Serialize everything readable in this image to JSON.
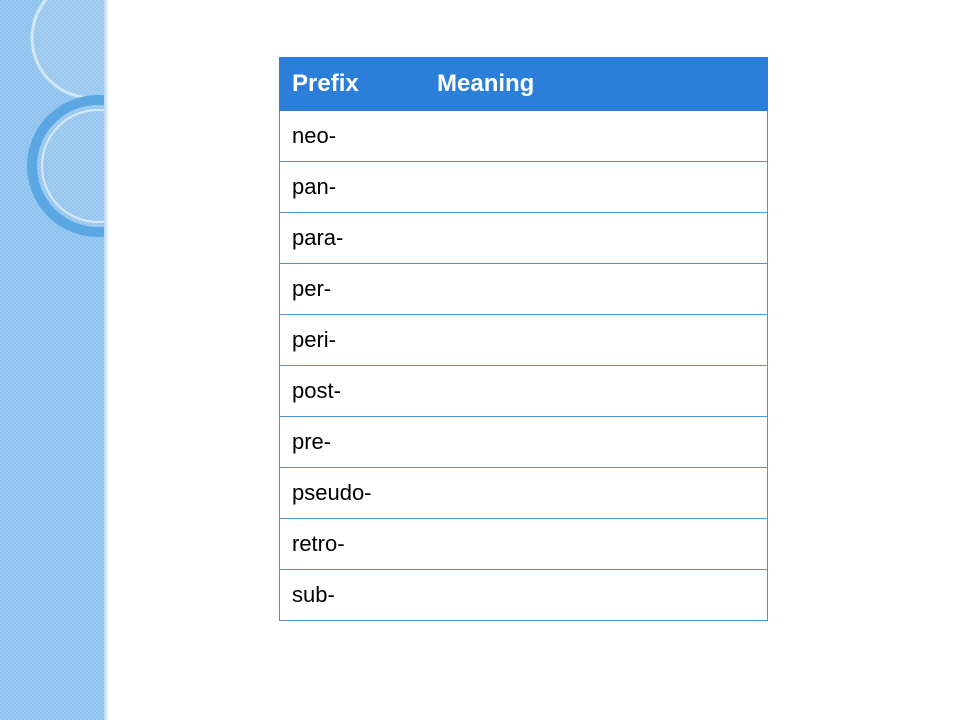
{
  "slide": {
    "table": {
      "headers": [
        "Prefix",
        "Meaning"
      ],
      "rows": [
        {
          "prefix": "neo-",
          "meaning": ""
        },
        {
          "prefix": "pan-",
          "meaning": ""
        },
        {
          "prefix": "para-",
          "meaning": ""
        },
        {
          "prefix": "per-",
          "meaning": ""
        },
        {
          "prefix": "peri-",
          "meaning": ""
        },
        {
          "prefix": "post-",
          "meaning": ""
        },
        {
          "prefix": "pre-",
          "meaning": ""
        },
        {
          "prefix": "pseudo-",
          "meaning": ""
        },
        {
          "prefix": "retro-",
          "meaning": ""
        },
        {
          "prefix": "sub-",
          "meaning": ""
        }
      ]
    },
    "colors": {
      "header_background": "#2b7fd8",
      "header_text": "#ffffff",
      "cell_border": "#4f93dc",
      "sidebar": "#8ec2ee"
    }
  }
}
